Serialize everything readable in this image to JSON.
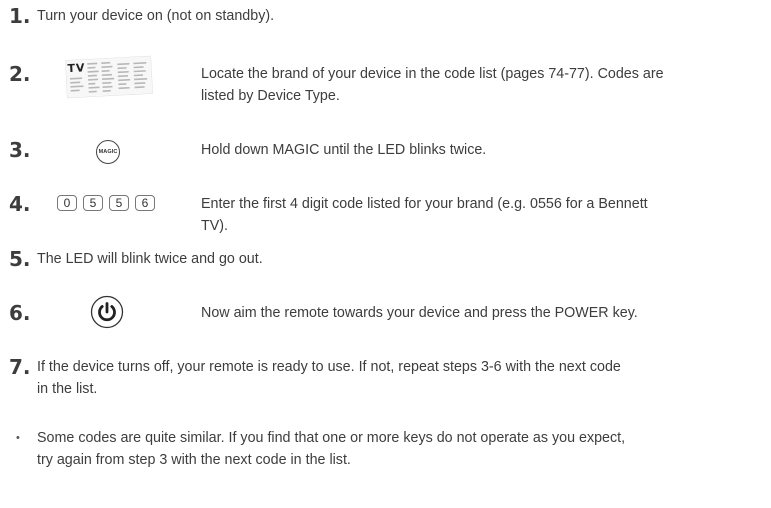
{
  "steps": [
    {
      "number": "1.",
      "text": "Turn your device on (not on standby)."
    },
    {
      "number": "2.",
      "line1": "Locate the brand of your device in the code list (pages 74-77). Codes are",
      "line2": "listed by Device Type.",
      "image_label": "TV"
    },
    {
      "number": "3.",
      "text": "Hold down MAGIC until the LED blinks twice.",
      "button_label": "MAGIC"
    },
    {
      "number": "4.",
      "line1": "Enter the first 4 digit code listed for your brand (e.g. 0556 for a Bennett",
      "line2": "TV).",
      "keys": [
        "0",
        "5",
        "5",
        "6"
      ]
    },
    {
      "number": "5.",
      "text": "The LED will blink twice and go out."
    },
    {
      "number": "6.",
      "text": "Now aim the remote towards your device and press the POWER key.",
      "icon": "power-icon"
    },
    {
      "number": "7.",
      "line1": "If the device turns off, your remote is ready to use. If not, repeat steps 3-6 with the next code",
      "line2": "in the list."
    }
  ],
  "note": {
    "bullet": "•",
    "line1": "Some codes are quite similar. If you find that one or more keys do not operate as you expect,",
    "line2": "try again from step 3 with the next code in the list."
  }
}
